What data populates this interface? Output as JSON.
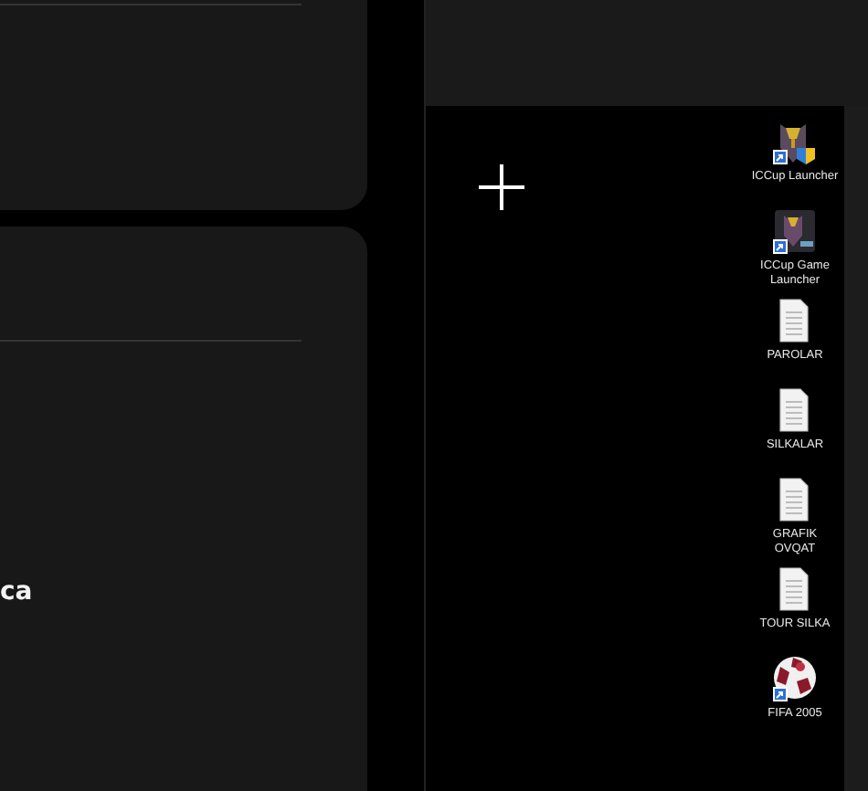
{
  "left_panel": {
    "text": "ca"
  },
  "desktop_icons": [
    {
      "label": "ICCup Launcher",
      "kind": "launcher",
      "shortcut": true
    },
    {
      "label": "ICCup Game Launcher",
      "kind": "game",
      "shortcut": true
    },
    {
      "label": "PAROLAR",
      "kind": "document",
      "shortcut": false
    },
    {
      "label": "SILKALAR",
      "kind": "document",
      "shortcut": false
    },
    {
      "label": "GRAFIK OVQAT",
      "kind": "document",
      "shortcut": false
    },
    {
      "label": "TOUR SILKA",
      "kind": "document",
      "shortcut": false
    },
    {
      "label": "FIFA 2005",
      "kind": "ball",
      "shortcut": true
    }
  ]
}
